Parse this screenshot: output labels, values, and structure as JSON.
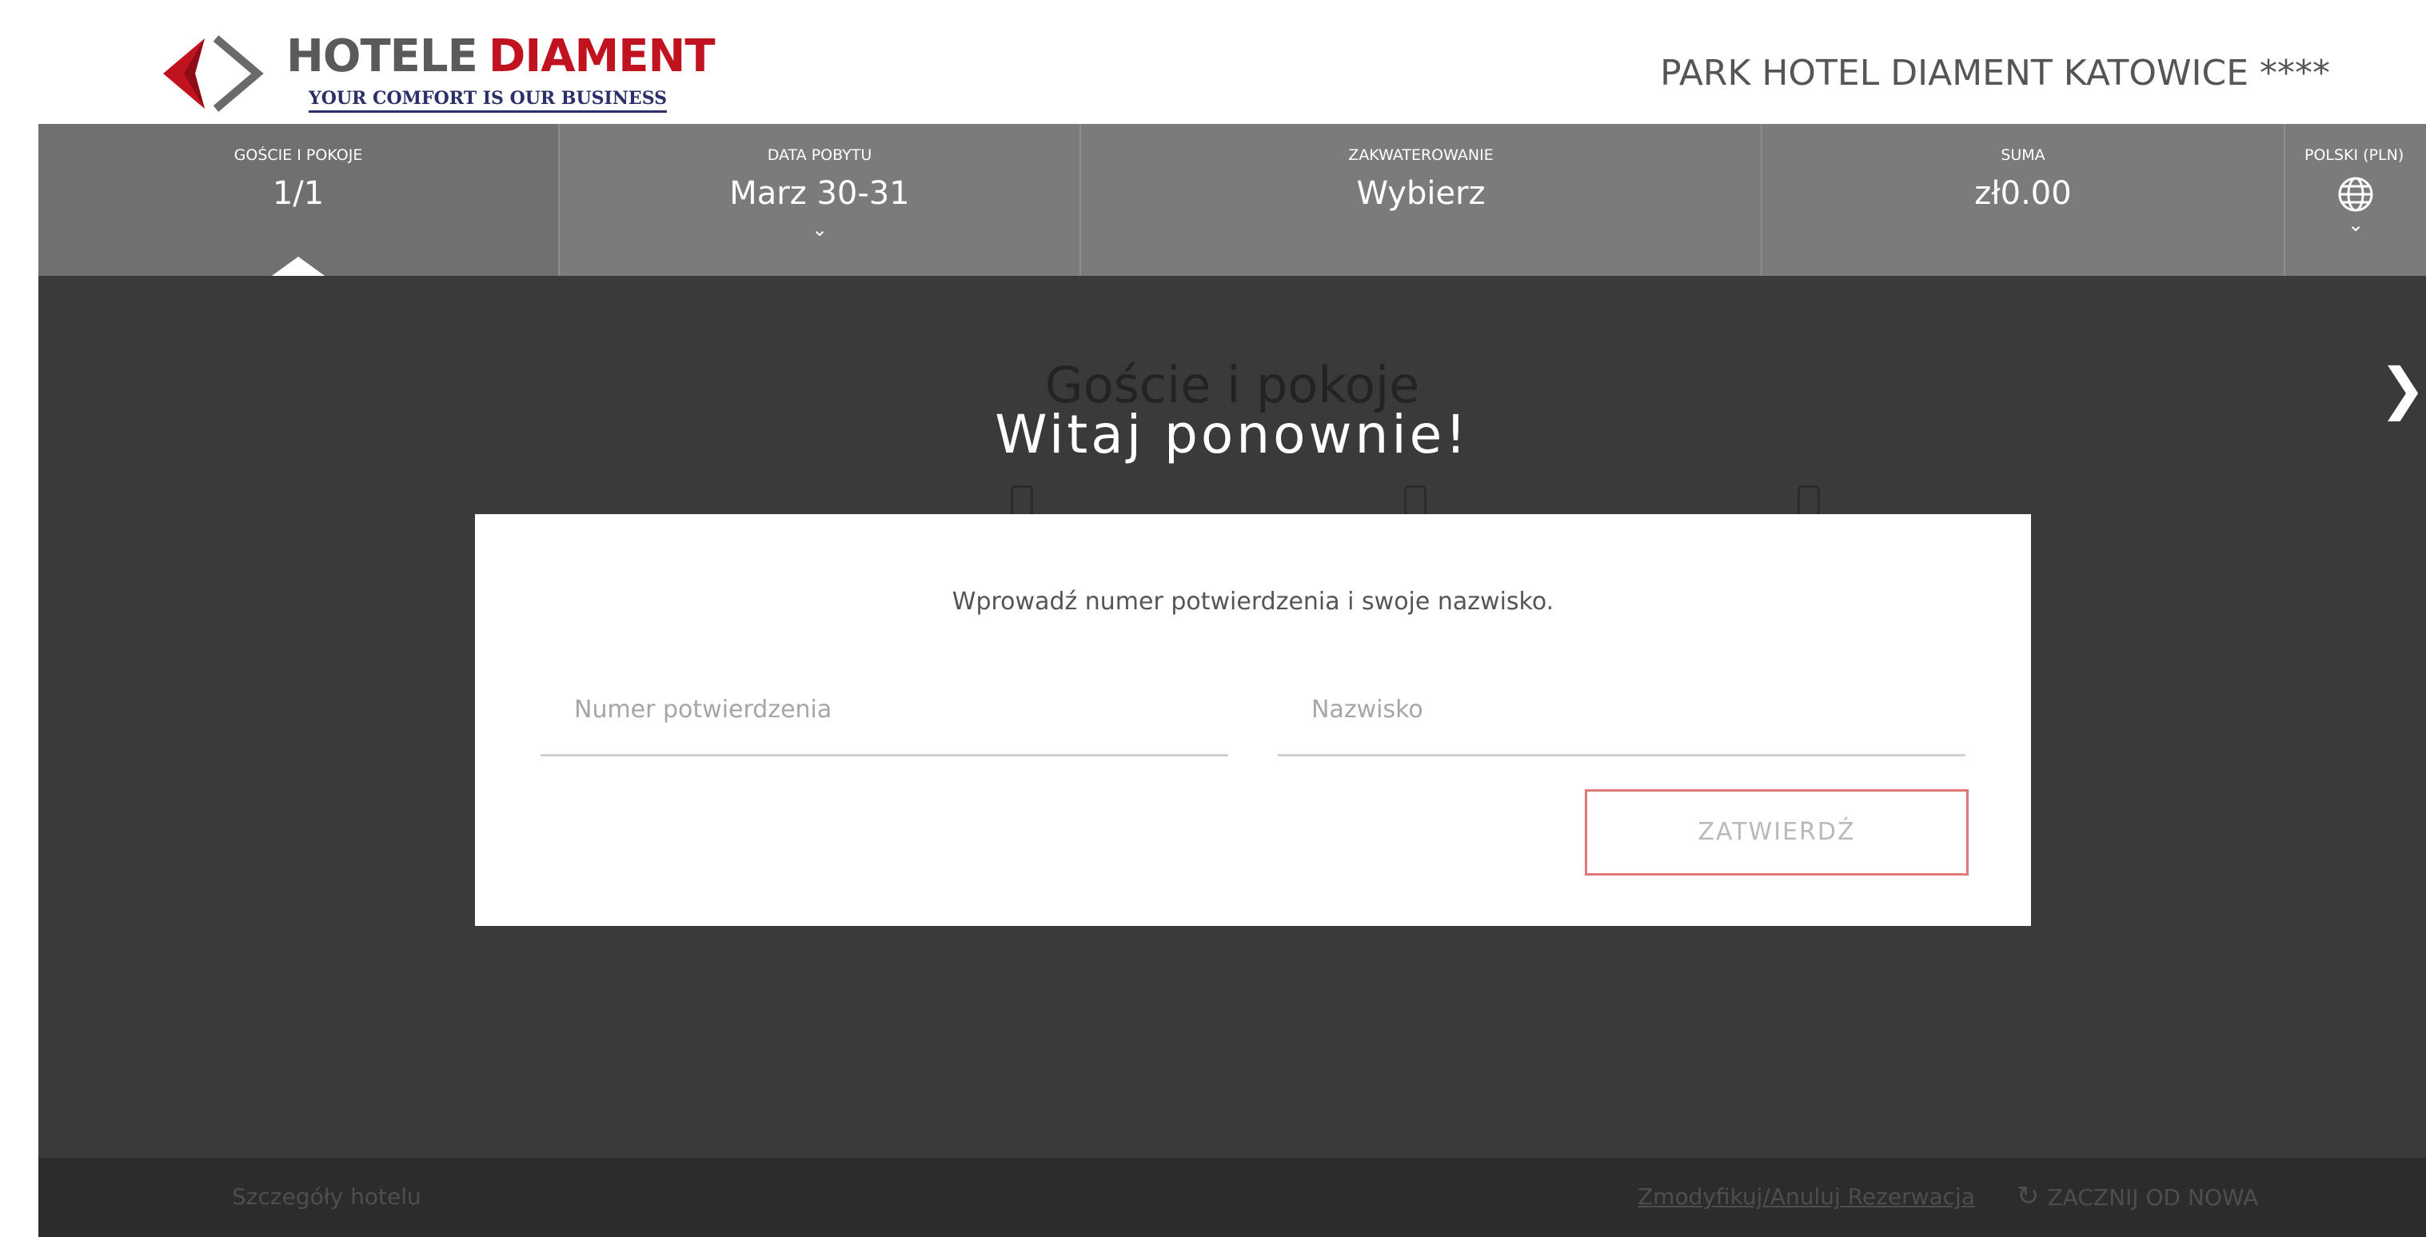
{
  "brand": {
    "name_part1": "HOTELE",
    "name_part2": "DIAMENT",
    "tagline": "YOUR COMFORT IS OUR BUSINESS"
  },
  "hotel_name": "PARK HOTEL DIAMENT KATOWICE ****",
  "nav": {
    "guests": {
      "label": "GOŚCIE I POKOJE",
      "value": "1/1"
    },
    "dates": {
      "label": "DATA POBYTU",
      "value": "Marz 30-31"
    },
    "accommodation": {
      "label": "ZAKWATEROWANIE",
      "value": "Wybierz"
    },
    "total": {
      "label": "SUMA",
      "value": "zł0.00"
    },
    "language": {
      "label": "POLSKI (PLN)"
    }
  },
  "overlay": {
    "background_title": "Goście i pokoje",
    "welcome": "Witaj ponownie!",
    "close_icon": "close-icon"
  },
  "modal": {
    "instruction": "Wprowadź numer potwierdzenia i swoje nazwisko.",
    "confirmation_placeholder": "Numer potwierdzenia",
    "surname_placeholder": "Nazwisko",
    "submit_label": "ZATWIERDŹ"
  },
  "footer": {
    "hotel_details": "Szczegóły hotelu",
    "modify_link": "Zmodyfikuj/Anuluj Rezerwacja",
    "restart": "ZACZNIJ OD NOWA"
  },
  "colors": {
    "brand_red": "#c1121f",
    "nav_bg": "#7a7b7c",
    "overlay_bg": "#3a3a3a",
    "button_border": "#e07a7a"
  }
}
